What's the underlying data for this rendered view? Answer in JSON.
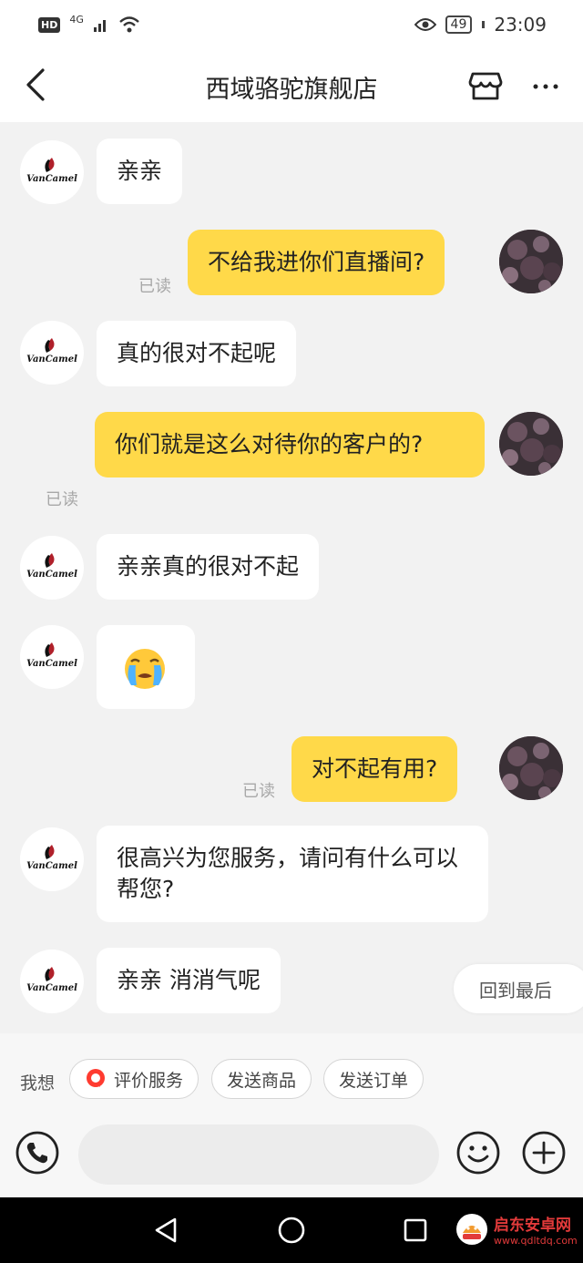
{
  "status_bar": {
    "hd": "HD",
    "network": "4G",
    "battery": "49",
    "time": "23:09"
  },
  "header": {
    "title": "西域骆驼旗舰店"
  },
  "messages": [
    {
      "from": "store",
      "text": "亲亲"
    },
    {
      "from": "user",
      "text": "不给我进你们直播间?",
      "read": "已读"
    },
    {
      "from": "store",
      "text": "真的很对不起呢"
    },
    {
      "from": "user",
      "text": "你们就是这么对待你的客户的?",
      "read": "已读"
    },
    {
      "from": "store",
      "text": "亲亲真的很对不起"
    },
    {
      "from": "store",
      "text": "😭"
    },
    {
      "from": "user",
      "text": "对不起有用?",
      "read": "已读"
    },
    {
      "from": "store",
      "text": "很高兴为您服务，请问有什么可以帮您?"
    },
    {
      "from": "store",
      "text": "亲亲 消消气呢"
    }
  ],
  "store_logo_text": "VanCamel",
  "jump_to_latest": "回到最后",
  "quick_actions": {
    "label": "我想",
    "items": [
      "评价服务",
      "发送商品",
      "发送订单"
    ]
  },
  "input": {
    "placeholder": ""
  },
  "watermark": {
    "title": "启东安卓网",
    "url": "www.qdltdq.com"
  },
  "colors": {
    "outgoing_bubble": "#ffd949",
    "incoming_bubble": "#ffffff",
    "background": "#f2f2f2"
  }
}
